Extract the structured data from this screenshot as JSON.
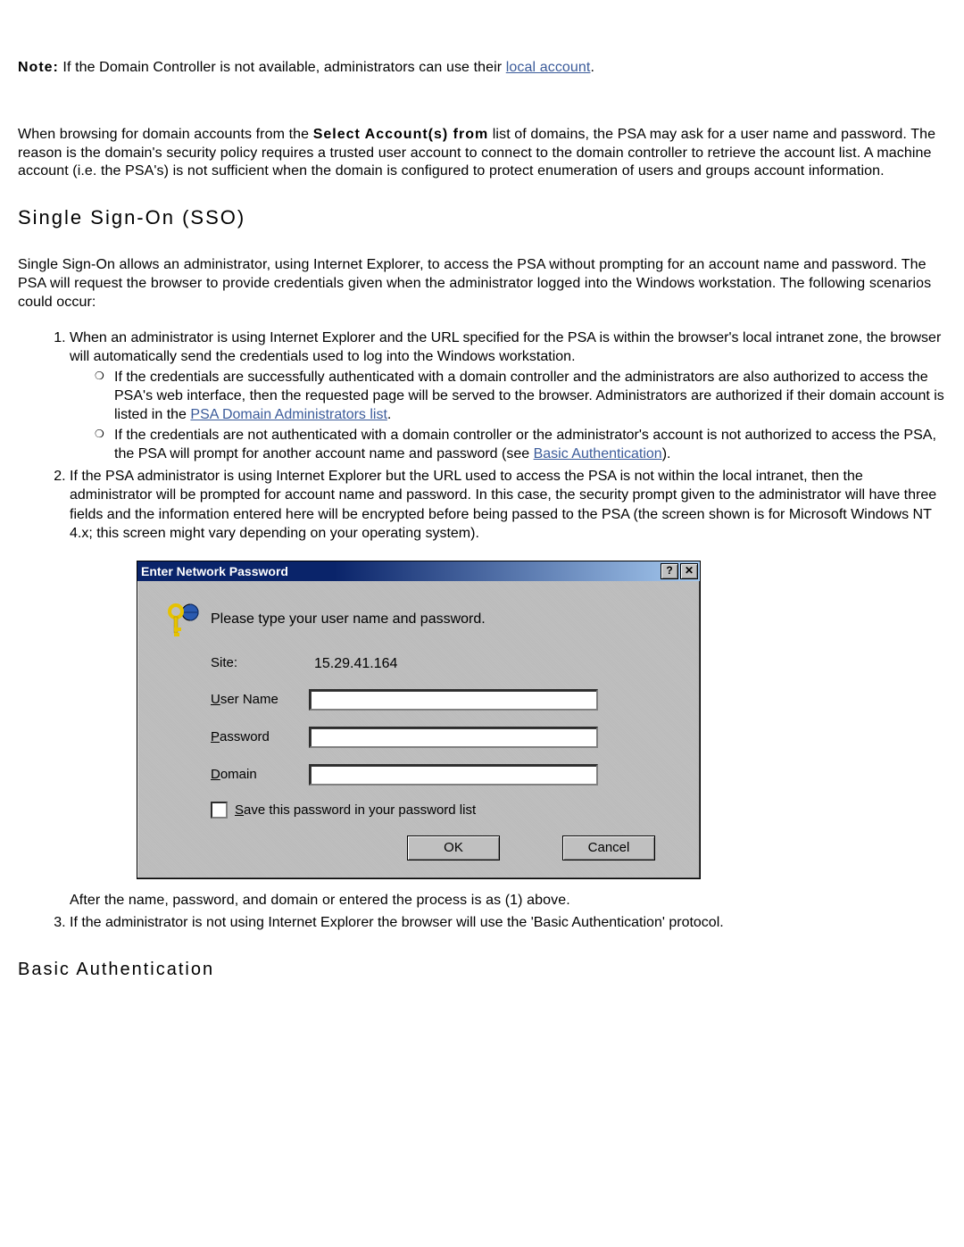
{
  "note": {
    "label": "Note:",
    "text_before": " If the Domain Controller is not available, administrators can use their ",
    "link": "local account",
    "text_after": "."
  },
  "para_browsing": {
    "t1": "When browsing for domain accounts from the ",
    "bold": "Select Account(s) from",
    "t2": " list of domains, the PSA may ask for a user name and password. The reason is the domain's security policy requires a trusted user account to connect to the domain controller to retrieve the account list. A machine account (i.e. the PSA's) is not sufficient when the domain is configured to protect enumeration of users and groups account information."
  },
  "sso": {
    "heading": "Single Sign-On (SSO)",
    "intro": "Single Sign-On allows an administrator, using Internet Explorer, to access the PSA without prompting for an account name and password. The PSA will request the browser to provide credentials given when the administrator logged into the Windows workstation. The following scenarios could occur:",
    "li1": "When an administrator is using Internet Explorer and the URL specified for the PSA is within the browser's local intranet zone, the browser will automatically send the credentials used to log into the Windows workstation.",
    "li1a_t1": "If the credentials are successfully authenticated with a domain controller and the administrators are also authorized to access the PSA's web interface, then the requested page will be served to the browser. Administrators are authorized if their domain account is listed in the ",
    "li1a_link": "PSA Domain Administrators list",
    "li1a_t2": ".",
    "li1b_t1": "If the credentials are not authenticated with a domain controller or the administrator's account is not authorized to access the PSA, the PSA will prompt for another account name and password (see ",
    "li1b_link": "Basic Authentication",
    "li1b_t2": ").",
    "li2": "If the PSA administrator is using Internet Explorer but the URL used to access the PSA is not within the local intranet, then the administrator will be prompted for account name and password. In this case, the security prompt given to the administrator will have three fields and the information entered here will be encrypted before being passed to the PSA (the screen shown is for Microsoft Windows NT 4.x; this screen might vary depending on your operating system).",
    "after_dlg": "After the name, password, and domain or entered the process is as (1) above.",
    "li3": "If the administrator is not using Internet Explorer the browser will use the 'Basic Authentication' protocol."
  },
  "dialog": {
    "title": "Enter Network Password",
    "message": "Please type your user name and password.",
    "site_label": "Site:",
    "site_value": "15.29.41.164",
    "user_u": "U",
    "user_rest": "ser Name",
    "pass_u": "P",
    "pass_rest": "assword",
    "dom_u": "D",
    "dom_rest": "omain",
    "save_u": "S",
    "save_rest": "ave this password in your password list",
    "ok": "OK",
    "cancel": "Cancel",
    "user_value": "",
    "pass_value": "",
    "dom_value": ""
  },
  "basic_auth_heading": "Basic Authentication"
}
